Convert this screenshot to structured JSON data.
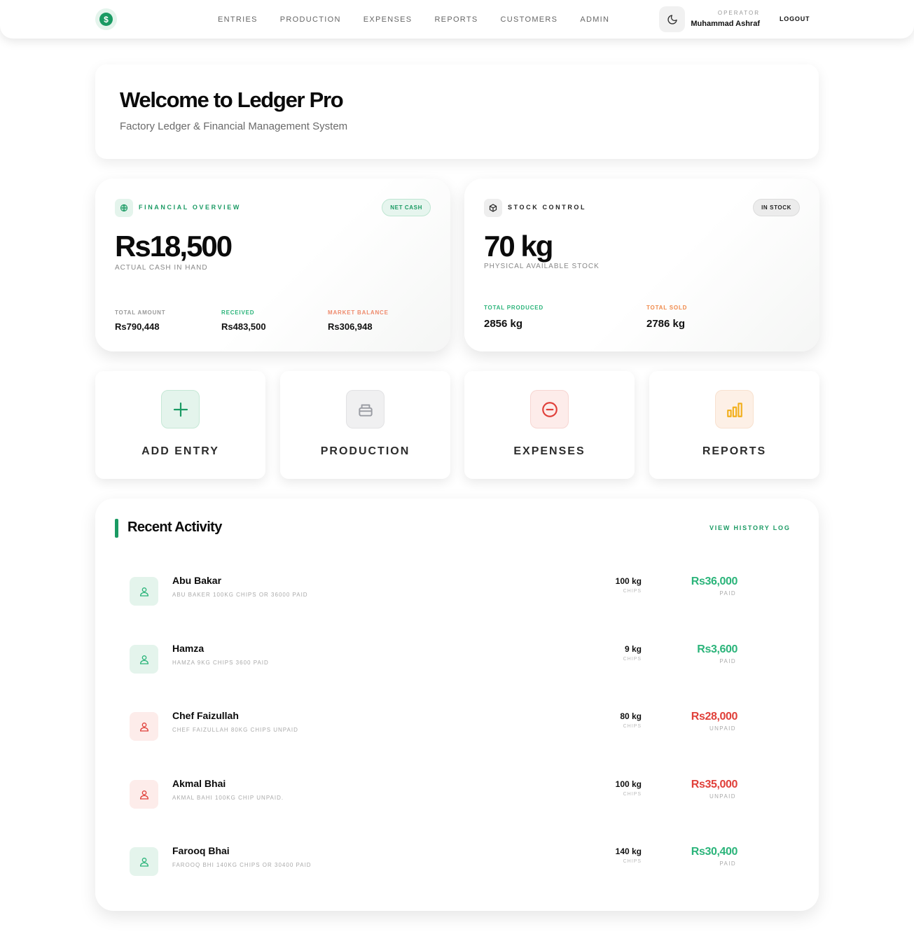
{
  "colors": {
    "accent": "#1a9a63",
    "paid": "#1a9a63",
    "unpaid": "#e0403a",
    "received": "#2bb47a",
    "market": "#ee8a6c",
    "sold": "#f08a4b"
  },
  "nav": {
    "logo_glyph": "$",
    "links": [
      "ENTRIES",
      "PRODUCTION",
      "EXPENSES",
      "REPORTS",
      "CUSTOMERS",
      "ADMIN"
    ],
    "operator_label": "OPERATOR",
    "operator_name": "Muhammad Ashraf",
    "logout": "LOGOUT",
    "theme_icon": "moon-icon"
  },
  "welcome": {
    "title": "Welcome to Ledger Pro",
    "subtitle": "Factory Ledger & Financial Management System"
  },
  "financial": {
    "title": "FINANCIAL OVERVIEW",
    "badge": "NET CASH",
    "amount": "Rs18,500",
    "amount_label": "ACTUAL CASH IN HAND",
    "stats": [
      {
        "label": "TOTAL AMOUNT",
        "value": "Rs790,448"
      },
      {
        "label": "RECEIVED",
        "value": "Rs483,500"
      },
      {
        "label": "MARKET BALANCE",
        "value": "Rs306,948"
      }
    ]
  },
  "stock": {
    "title": "STOCK CONTROL",
    "badge": "IN STOCK",
    "amount": "70 kg",
    "amount_label": "PHYSICAL AVAILABLE STOCK",
    "stats": [
      {
        "label": "TOTAL PRODUCED",
        "value": "2856 kg"
      },
      {
        "label": "TOTAL SOLD",
        "value": "2786 kg"
      }
    ]
  },
  "actions": [
    {
      "label": "ADD ENTRY",
      "icon": "plus-icon"
    },
    {
      "label": "PRODUCTION",
      "icon": "production-icon"
    },
    {
      "label": "EXPENSES",
      "icon": "minus-circle-icon"
    },
    {
      "label": "REPORTS",
      "icon": "bar-chart-icon"
    }
  ],
  "activity": {
    "title": "Recent Activity",
    "link": "VIEW HISTORY LOG",
    "items": [
      {
        "name": "Abu Bakar",
        "desc": "Abu baker 100kg chips or 36000 paid",
        "qty": "100 kg",
        "unit": "CHIPS",
        "amount": "Rs36,000",
        "status": "PAID"
      },
      {
        "name": "Hamza",
        "desc": "Hamza 9kg chips 3600 paid",
        "qty": "9 kg",
        "unit": "CHIPS",
        "amount": "Rs3,600",
        "status": "PAID"
      },
      {
        "name": "Chef Faizullah",
        "desc": "Chef Faizullah 80kg chips unpaid",
        "qty": "80 kg",
        "unit": "CHIPS",
        "amount": "Rs28,000",
        "status": "UNPAID"
      },
      {
        "name": "Akmal Bhai",
        "desc": "Akmal bahi 100kg chip unpaid.",
        "qty": "100 kg",
        "unit": "CHIPS",
        "amount": "Rs35,000",
        "status": "UNPAID"
      },
      {
        "name": "Farooq Bhai",
        "desc": "Farooq bhi 140kg chips or 30400 paid",
        "qty": "140 kg",
        "unit": "CHIPS",
        "amount": "Rs30,400",
        "status": "PAID"
      }
    ]
  }
}
